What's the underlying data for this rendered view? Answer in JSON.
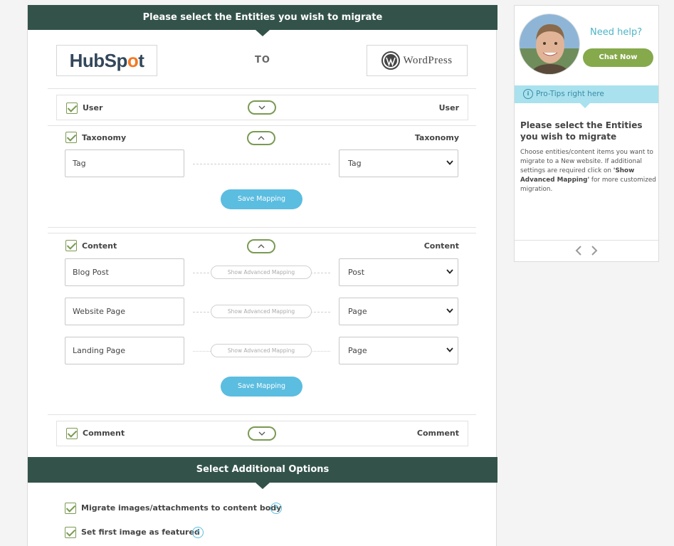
{
  "header": {
    "title": "Please select the Entities you wish to migrate"
  },
  "source_logo": {
    "text_left": "HubSp",
    "text_o": "o",
    "text_right": "t"
  },
  "target_logo": {
    "text": "WordPress"
  },
  "to_label": "TO",
  "entities": {
    "user": {
      "label": "User",
      "target": "User"
    },
    "taxonomy": {
      "label": "Taxonomy",
      "target": "Taxonomy",
      "rows": [
        {
          "source": "Tag",
          "target": "Tag"
        }
      ],
      "save_label": "Save Mapping"
    },
    "content": {
      "label": "Content",
      "target": "Content",
      "rows": [
        {
          "source": "Blog Post",
          "target": "Post",
          "advanced": "Show Advanced Mapping"
        },
        {
          "source": "Website Page",
          "target": "Page",
          "advanced": "Show Advanced Mapping"
        },
        {
          "source": "Landing Page",
          "target": "Page",
          "advanced": "Show Advanced Mapping"
        }
      ],
      "save_label": "Save Mapping"
    },
    "comment": {
      "label": "Comment",
      "target": "Comment"
    }
  },
  "additional": {
    "title": "Select Additional Options",
    "options": [
      {
        "label": "Migrate images/attachments to content body",
        "checked": true
      },
      {
        "label": "Set first image as featured",
        "checked": true
      }
    ],
    "help_glyph": "?"
  },
  "side": {
    "need_help": "Need help?",
    "chat_label": "Chat Now",
    "protips_label": "Pro-Tips right here",
    "info_glyph": "i",
    "tip_title": "Please select the Entities you wish to migrate",
    "tip_body_1": "Choose entities/content items you want to migrate to a New website. If additional settings are required click on ",
    "tip_body_bold": "'Show Advanced Mapping'",
    "tip_body_2": " for more customized migration."
  },
  "colors": {
    "header": "#33534a",
    "accent_green": "#7a9a53",
    "save_blue": "#5bbde0",
    "chat_green": "#86a94c",
    "protips_bg": "#a9e1ee",
    "hubspot_orange": "#f57722"
  },
  "icons": {
    "toggle_collapsed": "chevron-down-icon",
    "toggle_expanded": "chevron-up-icon",
    "select_caret": "caret-down-icon",
    "carousel_prev": "chevron-left-icon",
    "carousel_next": "chevron-right-icon"
  }
}
